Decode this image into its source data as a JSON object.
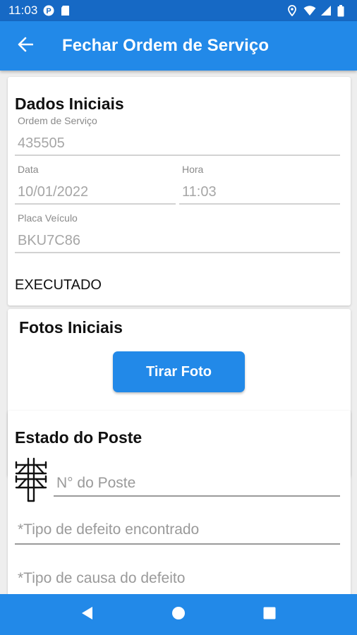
{
  "status_bar": {
    "time": "11:03",
    "icons_left": [
      "p-badge-icon",
      "sd-card-icon"
    ],
    "icons_right": [
      "location-icon",
      "wifi-icon",
      "signal-icon",
      "battery-icon"
    ]
  },
  "app_bar": {
    "title": "Fechar Ordem de Serviço",
    "back_icon": "arrow-back-icon"
  },
  "dados_iniciais": {
    "title": "Dados Iniciais",
    "ordem_servico": {
      "label": "Ordem de Serviço",
      "value": "435505"
    },
    "data": {
      "label": "Data",
      "value": "10/01/2022"
    },
    "hora": {
      "label": "Hora",
      "value": "11:03"
    },
    "placa": {
      "label": "Placa Veículo",
      "value": "BKU7C86"
    },
    "status": "EXECUTADO"
  },
  "fotos_iniciais": {
    "title": "Fotos Iniciais",
    "button_label": "Tirar Foto"
  },
  "estado_poste": {
    "title": "Estado do Poste",
    "poste_icon": "utility-pole-icon",
    "numero_placeholder": "N° do Poste",
    "tipo_defeito_placeholder": "*Tipo de defeito encontrado",
    "tipo_causa_placeholder": "*Tipo de causa do defeito"
  },
  "nav_bar": {
    "items": [
      "back-triangle-icon",
      "home-circle-icon",
      "recents-square-icon"
    ]
  },
  "colors": {
    "status_bar": "#1669c5",
    "primary": "#2289e8",
    "background": "#eeeeee"
  }
}
